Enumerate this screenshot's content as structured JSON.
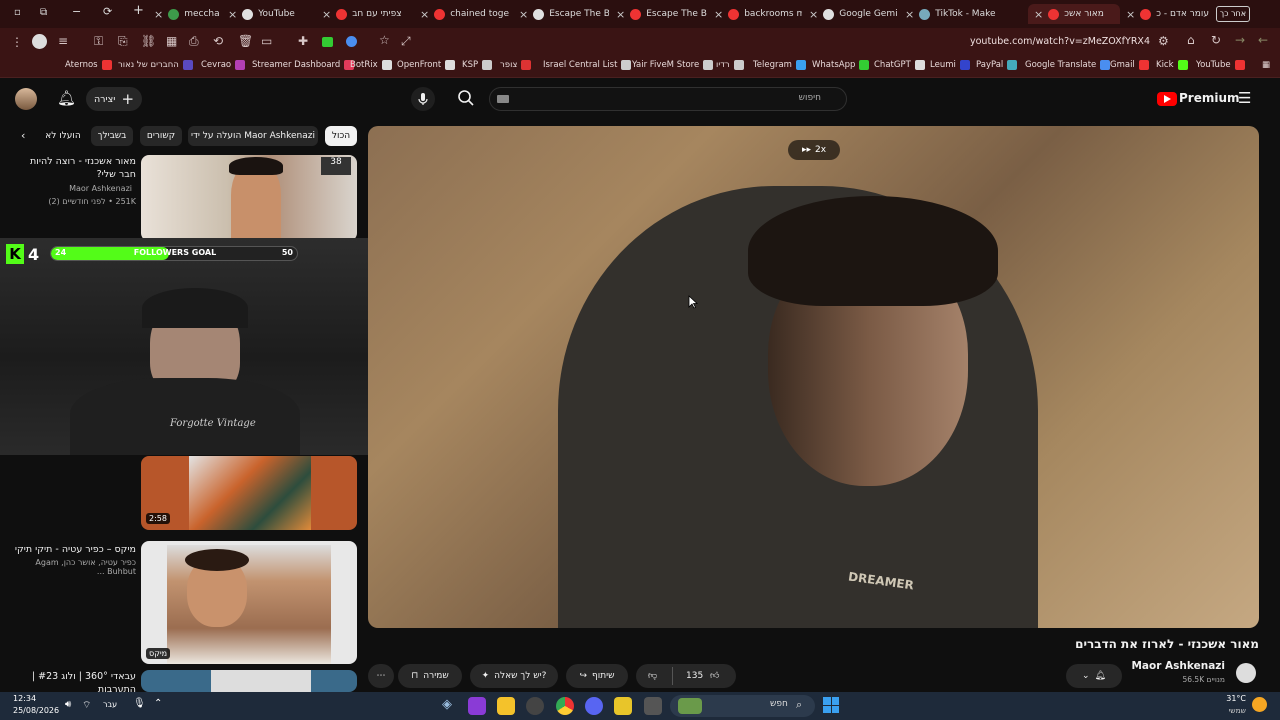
{
  "tabs": [
    {
      "label": "meccha cham",
      "color": "#3d9a4a"
    },
    {
      "label": "YouTube",
      "color": "#e0e0e0"
    },
    {
      "label": "צפיתי עם חב",
      "color": "#e33"
    },
    {
      "label": "chained toge",
      "color": "#e33"
    },
    {
      "label": "Escape The B",
      "color": "#e0e0e0"
    },
    {
      "label": "Escape The B",
      "color": "#e33"
    },
    {
      "label": "backrooms m",
      "color": "#e33"
    },
    {
      "label": "Google Gemi",
      "color": "#e0e0e0"
    },
    {
      "label": "TikTok - Make",
      "color": "#7ab"
    },
    {
      "label": "מאור אשכ",
      "color": "#e33"
    },
    {
      "label": "עומר אדם - כ",
      "color": "#e33"
    }
  ],
  "tab_other": "אחר כך",
  "url": "youtube.com/watch?v=zMeZOXfYRX4",
  "bookmarks": [
    "Aternos",
    "החברים של נאור",
    "Cevrao",
    "Streamer Dashboard",
    "BotRix",
    "OpenFront",
    "KSP",
    "צופר",
    "Israel Central List",
    "Yair FiveM Store",
    "רדיו",
    "Telegram",
    "WhatsApp",
    "ChatGPT",
    "Leumi",
    "PayPal",
    "Google Translate",
    "Gmail",
    "Kick",
    "YouTube"
  ],
  "header": {
    "logo": "Premium",
    "search_placeholder": "חיפוש",
    "create_label": "יצירה"
  },
  "chips": [
    "הכול",
    "הועלה על ידי Maor Ashkenazi",
    "קשורים",
    "בשבילך",
    "הועלו לא"
  ],
  "video": {
    "speed": "2x",
    "shirt_text": "DREAMER",
    "title": "מאור אשכנזי - לארוז את הדברים",
    "channel": "Maor Ashkenazi",
    "subscribers": "56.5K מנויים",
    "likes": "135",
    "share_label": "שיתוף",
    "ask_label": "יש לך שאלה?",
    "save_label": "שמירה"
  },
  "related": [
    {
      "title": "מאור אשכנזי - רוצה להיות חבר שלי?",
      "channel": "Maor Ashkenazi",
      "meta": "251K • לפני חודשיים (2)"
    },
    {
      "title": "",
      "channel": "",
      "meta": "",
      "duration": "2:58"
    },
    {
      "title": "מיקס – כפיר עטיה - תיקי תיקי",
      "channel": "כפיר עטיה, אושר כהן, Agam Buhbut ...",
      "meta": "",
      "badge": "מיקס"
    },
    {
      "title": "עבאדי 360° | ולוג #23 | התערבות",
      "channel": "",
      "meta": ""
    }
  ],
  "overlay": {
    "kick_number": "4",
    "goal_label": "FOLLOWERS GOAL",
    "goal_current": "24",
    "goal_target": "50",
    "goal_progress": 0.48,
    "shirt_text": "Forgotte Vintage"
  },
  "taskbar": {
    "time": "12:34",
    "date": "25/08/2026",
    "search_label": "חפש",
    "weather": "31°C",
    "weather_sub": "שמשי",
    "lang": "עבר"
  }
}
